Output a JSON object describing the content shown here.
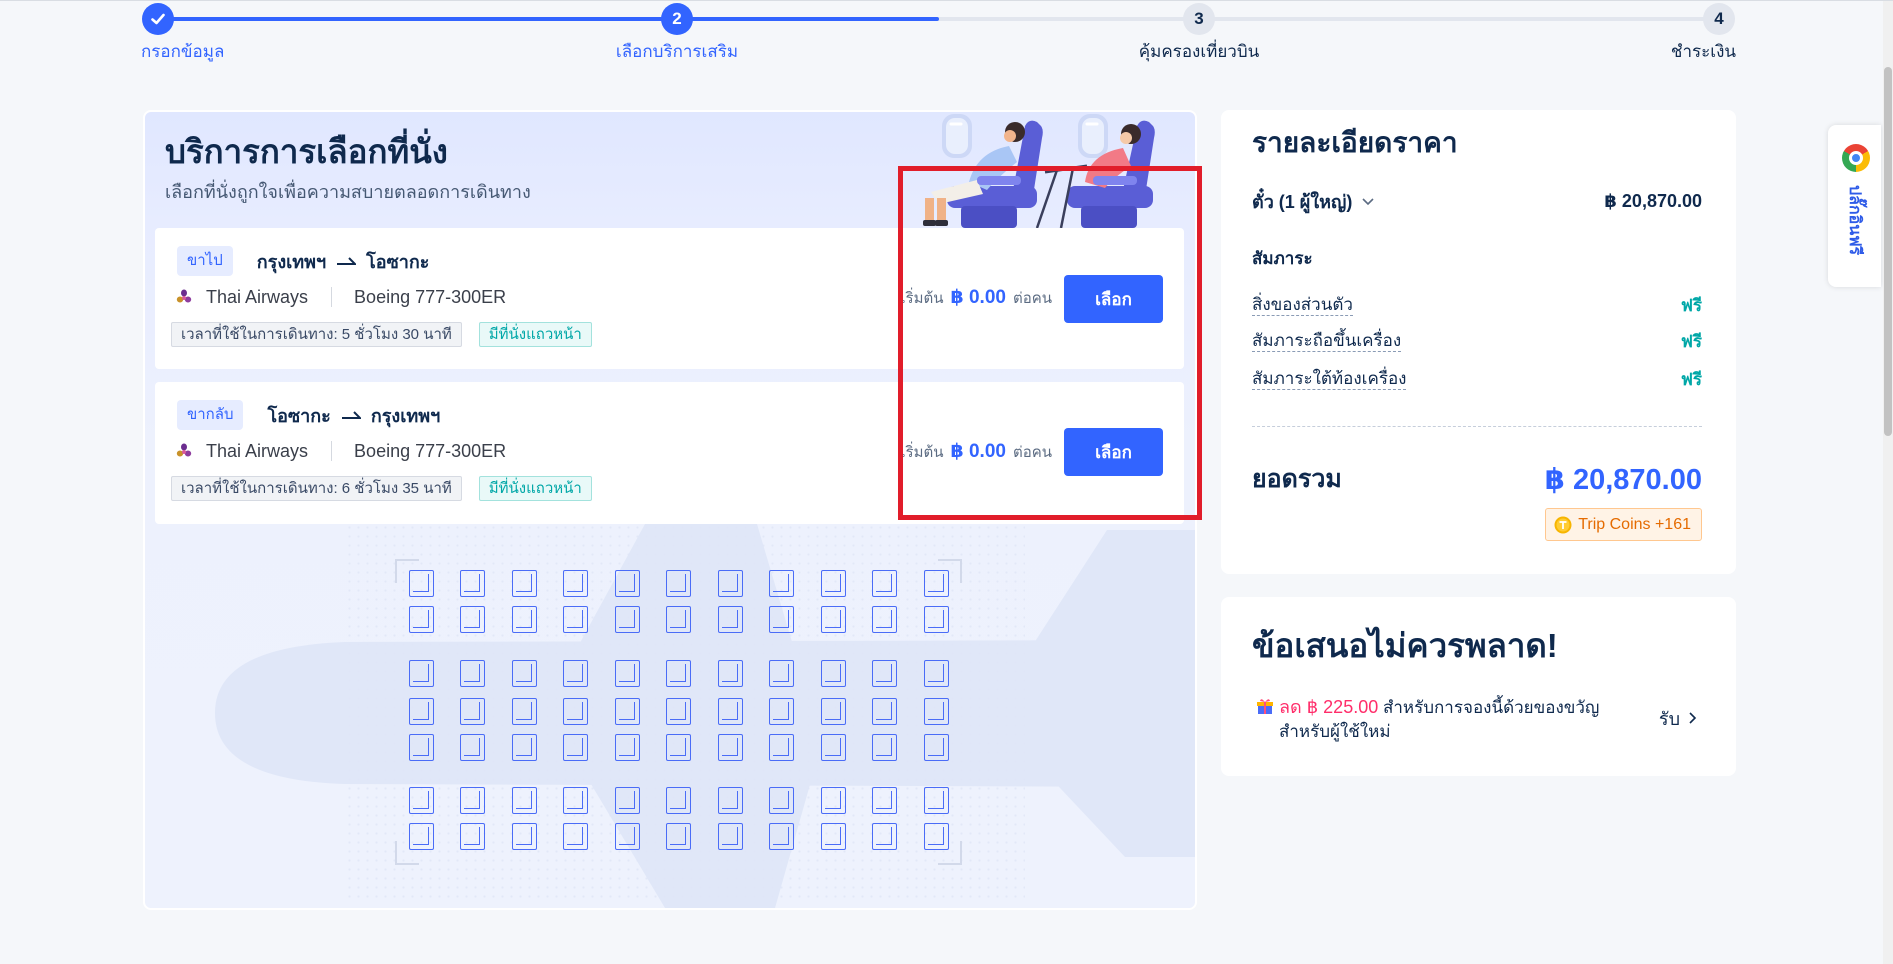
{
  "theme": {
    "accent": "#3264ff",
    "heading": "#0f294d",
    "free": "#00a7a7",
    "discount": "#ff2d6a",
    "coins": "#e56b00",
    "highlight": "#e11d2a"
  },
  "stepper": {
    "progress": 0.5,
    "steps": [
      {
        "label": "กรอกข้อมูล",
        "completed": true,
        "current": false,
        "icon": "check-icon"
      },
      {
        "number": "2",
        "label": "เลือกบริการเสริม",
        "completed": false,
        "current": true
      },
      {
        "number": "3",
        "label": "คุ้มครองเที่ยวบิน",
        "completed": false,
        "current": false
      },
      {
        "number": "4",
        "label": "ชำระเงิน",
        "completed": false,
        "current": false
      }
    ]
  },
  "seat_service": {
    "title": "บริการการเลือกที่นั่ง",
    "subtitle": "เลือกที่นั่งถูกใจเพื่อความสบายตลอดการเดินทาง",
    "flights": [
      {
        "direction": "ขาไป",
        "origin": "กรุงเทพฯ",
        "destination": "โอซากะ",
        "airline_logo": "thai-airways-logo-icon",
        "airline": "Thai Airways",
        "aircraft": "Boeing 777-300ER",
        "duration": "เวลาที่ใช้ในการเดินทาง: 5 ชั่วโมง 30 นาที",
        "feature_tag": "มีที่นั่งแถวหน้า",
        "price_prefix": "เริ่มต้น",
        "price": "฿ 0.00",
        "price_suffix": "ต่อคน",
        "select_label": "เลือก"
      },
      {
        "direction": "ขากลับ",
        "origin": "โอซากะ",
        "destination": "กรุงเทพฯ",
        "airline_logo": "thai-airways-logo-icon",
        "airline": "Thai Airways",
        "aircraft": "Boeing 777-300ER",
        "duration": "เวลาที่ใช้ในการเดินทาง: 6 ชั่วโมง 35 นาที",
        "feature_tag": "มีที่นั่งแถวหน้า",
        "price_prefix": "เริ่มต้น",
        "price": "฿ 0.00",
        "price_suffix": "ต่อคน",
        "select_label": "เลือก"
      }
    ]
  },
  "price_details": {
    "title": "รายละเอียดราคา",
    "ticket_label": "ตั๋ว (1 ผู้ใหญ่)",
    "ticket_price": "฿ 20,870.00",
    "baggage_heading": "สัมภาระ",
    "baggage_items": [
      {
        "label": "สิ่งของส่วนตัว",
        "value": "ฟรี"
      },
      {
        "label": "สัมภาระถือขึ้นเครื่อง",
        "value": "ฟรี"
      },
      {
        "label": "สัมภาระใต้ท้องเครื่อง",
        "value": "ฟรี"
      }
    ],
    "total_label": "ยอดรวม",
    "total_price": "฿ 20,870.00",
    "coins": "Trip Coins +161"
  },
  "offer": {
    "title": "ข้อเสนอไม่ควรพลาด!",
    "discount": "ลด ฿ 225.00",
    "text_line1": "สำหรับการจองนี้ด้วยของขวัญ",
    "text_line2": "สำหรับผู้ใช้ใหม่",
    "cta": "รับ"
  },
  "extension": {
    "icon": "chrome-icon",
    "label": "ปลั๊กอินฟรี"
  }
}
